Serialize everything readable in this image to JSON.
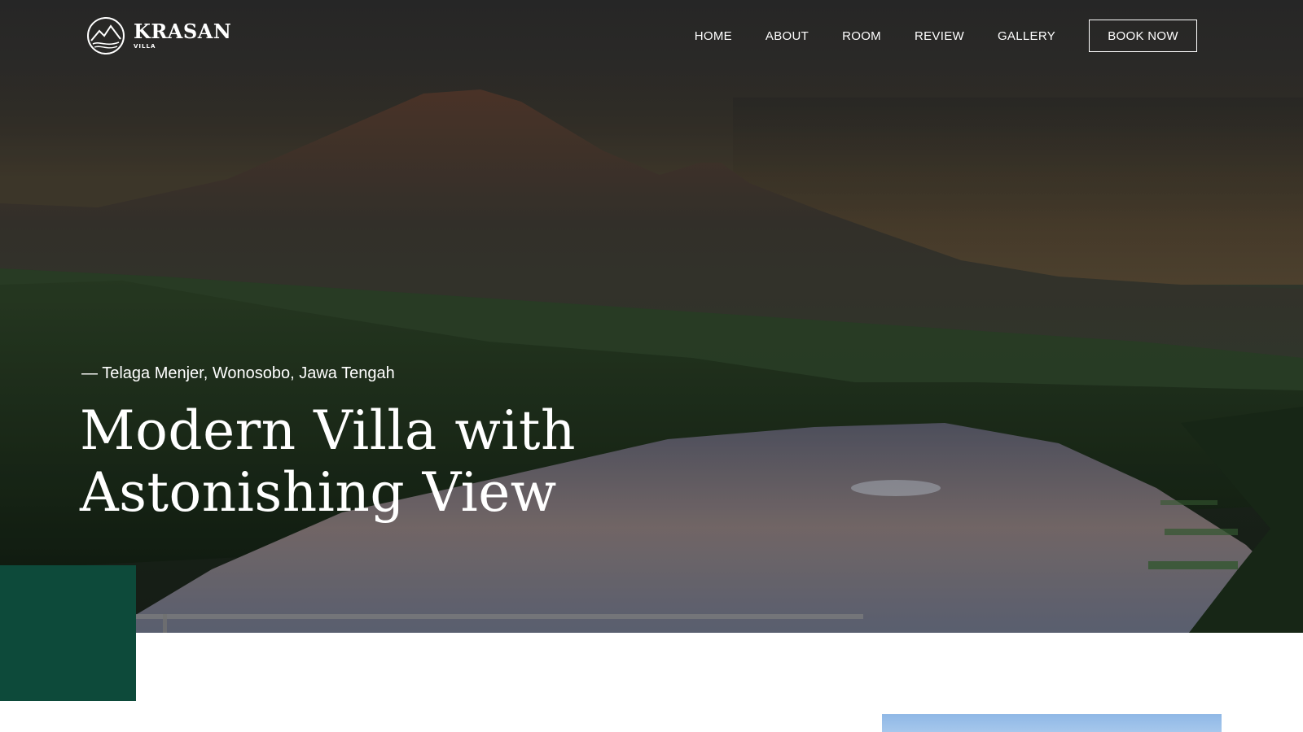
{
  "brand": {
    "name": "KRASAN",
    "subtitle": "VILLA"
  },
  "nav": {
    "items": [
      "HOME",
      "ABOUT",
      "ROOM",
      "REVIEW",
      "GALLERY"
    ],
    "cta": "BOOK NOW"
  },
  "hero": {
    "location": "— Telaga Menjer, Wonosobo, Jawa Tengah",
    "headline_line1": "Modern Villa with",
    "headline_line2": "Astonishing View"
  },
  "colors": {
    "accent_green": "#0d4a3a",
    "text_on_hero": "#ffffff"
  }
}
